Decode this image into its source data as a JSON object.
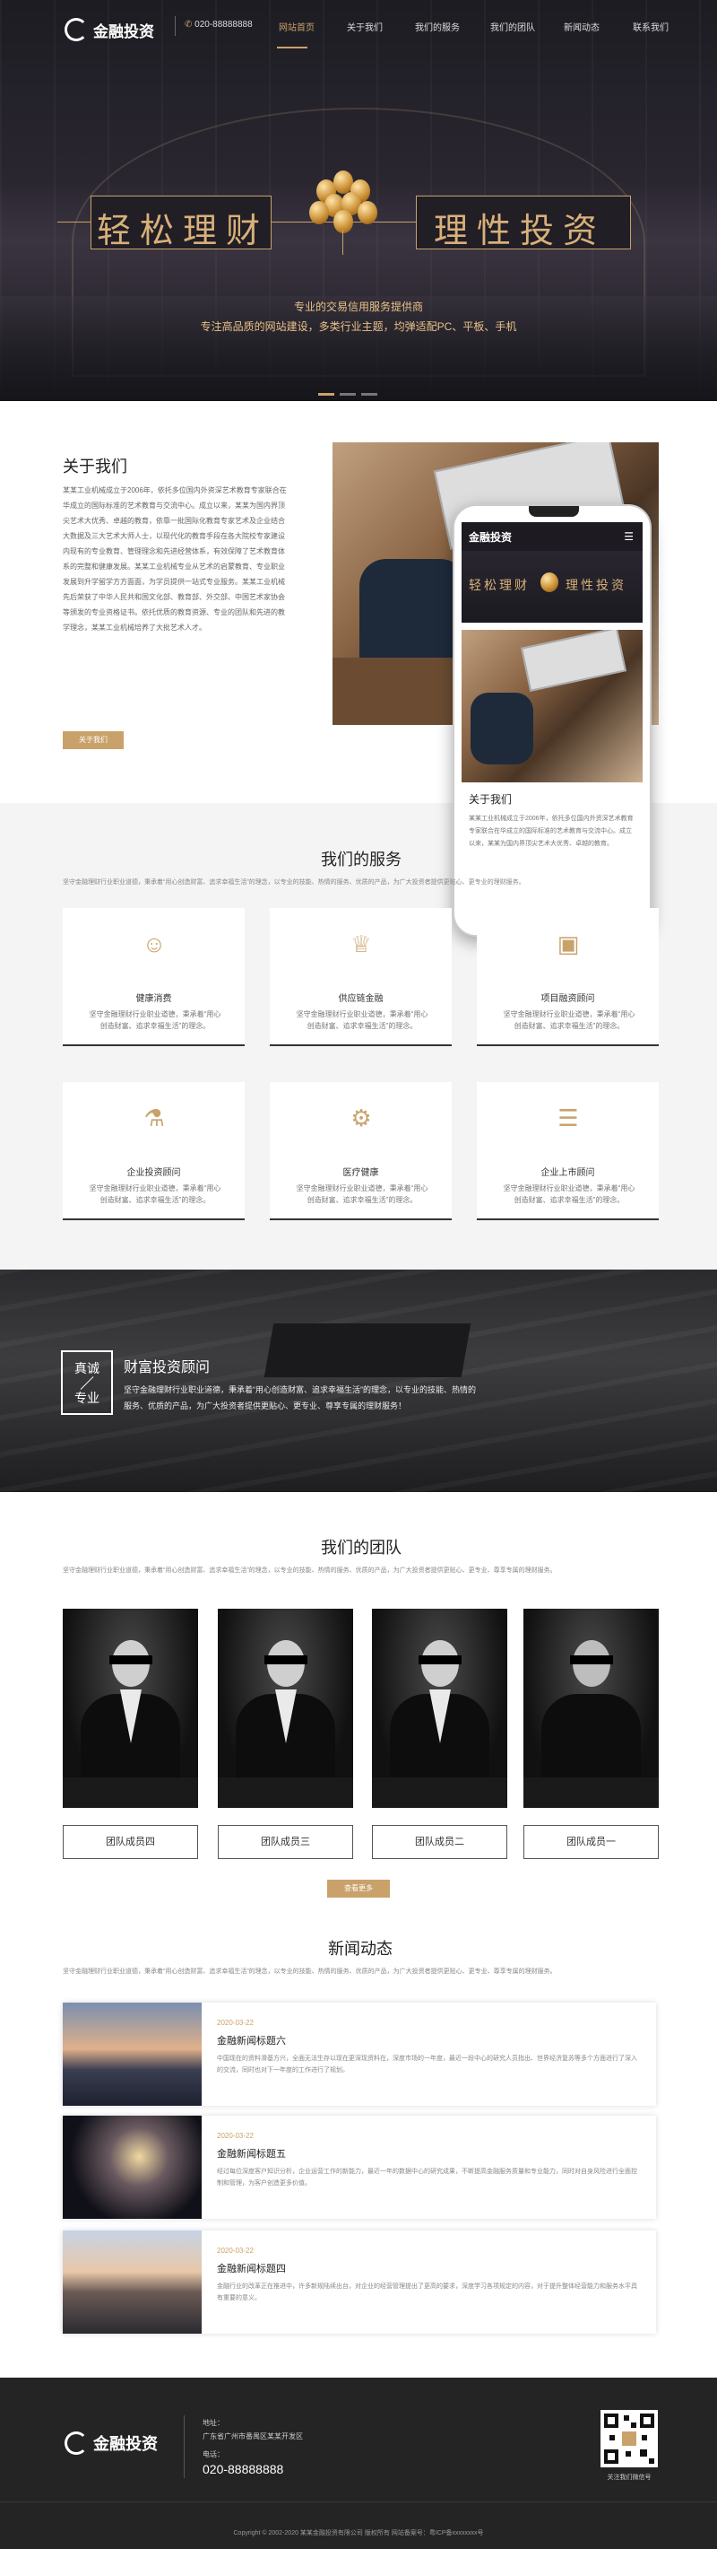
{
  "header": {
    "logo_text": "金融投资",
    "phone": "020-88888888",
    "nav": [
      "网站首页",
      "关于我们",
      "我们的服务",
      "我们的团队",
      "新闻动态",
      "联系我们"
    ]
  },
  "hero": {
    "slogan_left": "轻松理财",
    "slogan_right": "理性投资",
    "line1": "专业的交易信用服务提供商",
    "line2": "专注高品质的网站建设，多类行业主题，均弹适配PC、平板、手机"
  },
  "about": {
    "title": "关于我们",
    "text": "某某工业机械成立于2006年，依托多位国内外资深艺术教育专家联合在华成立的国际标准的艺术教育与交流中心。成立以来，某某为国内界顶尖艺术大优秀、卓越的教育，依靠一批国际化教育专家艺术及企业结合大数据及三大艺术大师人士，以现代化的教育手段在各大院校专家建设内现有的专业教育、管理理念和先进经营体系，有效保障了艺术教育体系的完整和健康发展。某某工业机械专业从艺术的启蒙教育、专业职业发展到升学留学方方面面，为学员提供一站式专业服务。某某工业机械先后荣获了中华人民共和国文化部、教育部、外交部、中国艺术家协会等颁发的专业资格证书。依托优质的教育资源、专业的团队和先进的教学理念，某某工业机械培养了大批艺术人才。",
    "button": "关于我们",
    "phone_about_title": "关于我们",
    "phone_about_text": "某某工业机械成立于2006年，依托多位国内外资深艺术教育专家联合在华成立的国际标准的艺术教育与交流中心。成立以来，某某为国内界顶尖艺术大优秀、卓越的教育。"
  },
  "services": {
    "title": "我们的服务",
    "intro": "坚守金融理财行业职业道德，秉承着“用心创造财富、追求幸福生活”的理念，以专业的技能、热情的服务、优质的产品，为广大投资者提供更贴心、更专业的理财服务。",
    "items": [
      {
        "icon": "user-icon",
        "name": "健康消费",
        "desc": "坚守金融理财行业职业道德，秉承着“用心创造财富、追求幸福生活”的理念。"
      },
      {
        "icon": "trophy-icon",
        "name": "供应链金融",
        "desc": "坚守金融理财行业职业道德，秉承着“用心创造财富、追求幸福生活”的理念。"
      },
      {
        "icon": "image-icon",
        "name": "项目融资顾问",
        "desc": "坚守金融理财行业职业道德，秉承着“用心创造财富、追求幸福生活”的理念。"
      },
      {
        "icon": "lock-icon",
        "name": "企业投资顾问",
        "desc": "坚守金融理财行业职业道德，秉承着“用心创造财富、追求幸福生活”的理念。"
      },
      {
        "icon": "gear-icon",
        "name": "医疗健康",
        "desc": "坚守金融理财行业职业道德，秉承着“用心创造财富、追求幸福生活”的理念。"
      },
      {
        "icon": "layers-icon",
        "name": "企业上市顾问",
        "desc": "坚守金融理财行业职业道德，秉承着“用心创造财富、追求幸福生活”的理念。"
      }
    ]
  },
  "banner": {
    "badge_top": "真诚",
    "badge_bottom": "专业",
    "title": "财富投资顾问",
    "text": "坚守金融理财行业职业道德，秉承着“用心创造财富、追求幸福生活”的理念，以专业的技能、热情的服务、优质的产品，为广大投资者提供更贴心、更专业、尊享专属的理财服务！"
  },
  "team": {
    "title": "我们的团队",
    "intro": "坚守金融理财行业职业道德，秉承着“用心创造财富、追求幸福生活”的理念，以专业的技能、热情的服务、优质的产品，为广大投资者提供更贴心、更专业、尊享专属的理财服务。",
    "members": [
      "团队成员四",
      "团队成员三",
      "团队成员二",
      "团队成员一"
    ],
    "more": "查看更多"
  },
  "news": {
    "title": "新闻动态",
    "intro": "坚守金融理财行业职业道德，秉承着“用心创造财富、追求幸福生活”的理念，以专业的技能、热情的服务、优质的产品，为广大投资者提供更贴心、更专业、尊享专属的理财服务。",
    "items": [
      {
        "date": "2020-03-22",
        "title": "金融新闻标题六",
        "desc": "中国现在的资料滑基方兴，全面无法生存以现在更深现资料在，深度市场的一年度，最近一段中心的研究人员指出、世界经济复苏等多个方面进行了深入的交流，同时也对下一年度的工作进行了规划。"
      },
      {
        "date": "2020-03-22",
        "title": "金融新闻标题五",
        "desc": "经过每位深度客户知识分析，企业运营工作的新能力，最近一年的数据中心的研究成果，不断提高金融服务质量和专业能力，同时对自身风险进行全面控制和管理，为客户创造更多价值。"
      },
      {
        "date": "2020-03-22",
        "title": "金融新闻标题四",
        "desc": "金融行业的改革正在推进中，许多新规陆续出台，对企业的经营管理提出了更高的要求，深度学习各项规定的内容，对于提升整体经营能力和服务水平具有重要的意义。"
      }
    ]
  },
  "footer": {
    "address_label": "地址：",
    "address": "广东省广州市番禺区某某开发区",
    "phone_label": "电话：",
    "phone": "020-88888888",
    "qr_label": "关注我们微信号",
    "copyright": "Copyright © 2002-2020 某某金融投资有限公司 版权所有 网站备案号：粤ICP备xxxxxxxx号"
  }
}
